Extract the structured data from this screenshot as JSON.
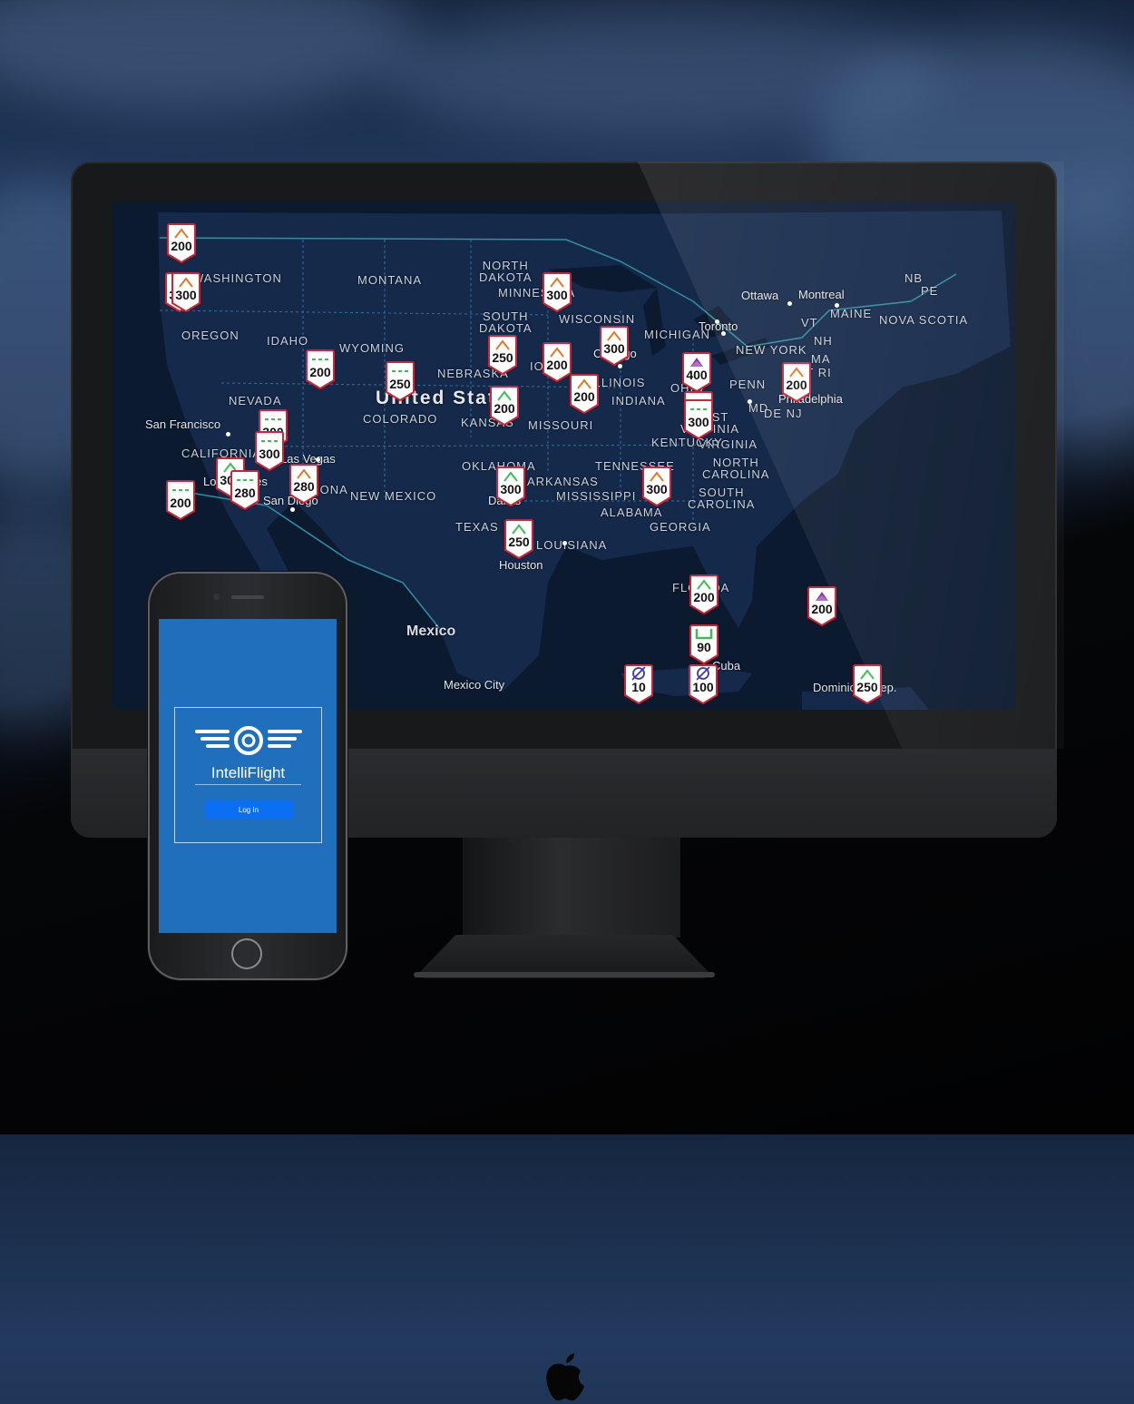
{
  "map": {
    "labels": [
      {
        "text": "NORTH\nDAKOTA",
        "type": "state"
      },
      {
        "text": "MONTANA",
        "type": "state"
      },
      {
        "text": "WASHINGTON",
        "type": "state"
      },
      {
        "text": "OREGON",
        "type": "state"
      },
      {
        "text": "IDAHO",
        "type": "state"
      },
      {
        "text": "WYOMING",
        "type": "state"
      },
      {
        "text": "SOUTH\nDAKOTA",
        "type": "state"
      },
      {
        "text": "NEBRASKA",
        "type": "state"
      },
      {
        "text": "NEVADA",
        "type": "state"
      },
      {
        "text": "COLORADO",
        "type": "state"
      },
      {
        "text": "KANSAS",
        "type": "state"
      },
      {
        "text": "MISSOURI",
        "type": "state"
      },
      {
        "text": "MINNESOTA",
        "type": "state"
      },
      {
        "text": "WISCONSIN",
        "type": "state"
      },
      {
        "text": "MICHIGAN",
        "type": "state"
      },
      {
        "text": "IOWA",
        "type": "state"
      },
      {
        "text": "ILLINOIS",
        "type": "state"
      },
      {
        "text": "INDIANA",
        "type": "state"
      },
      {
        "text": "OHIO",
        "type": "state"
      },
      {
        "text": "PENN",
        "type": "state"
      },
      {
        "text": "NEW YORK",
        "type": "state"
      },
      {
        "text": "VT",
        "type": "state"
      },
      {
        "text": "NH",
        "type": "state"
      },
      {
        "text": "MA",
        "type": "state"
      },
      {
        "text": "CT RI",
        "type": "state"
      },
      {
        "text": "MAINE",
        "type": "state"
      },
      {
        "text": "NB",
        "type": "state"
      },
      {
        "text": "PE",
        "type": "state"
      },
      {
        "text": "NOVA SCOTIA",
        "type": "state"
      },
      {
        "text": "MD",
        "type": "state"
      },
      {
        "text": "DE NJ",
        "type": "state"
      },
      {
        "text": "WEST\nVIRGINIA",
        "type": "state"
      },
      {
        "text": "VIRGINIA",
        "type": "state"
      },
      {
        "text": "KENTUCKY",
        "type": "state"
      },
      {
        "text": "TENNESSEE",
        "type": "state"
      },
      {
        "text": "NORTH\nCAROLINA",
        "type": "state"
      },
      {
        "text": "SOUTH\nCAROLINA",
        "type": "state"
      },
      {
        "text": "GEORGIA",
        "type": "state"
      },
      {
        "text": "ALABAMA",
        "type": "state"
      },
      {
        "text": "MISSISSIPPI",
        "type": "state"
      },
      {
        "text": "ARKANSAS",
        "type": "state"
      },
      {
        "text": "LOUISIANA",
        "type": "state"
      },
      {
        "text": "OKLAHOMA",
        "type": "state"
      },
      {
        "text": "TEXAS",
        "type": "state"
      },
      {
        "text": "NEW MEXICO",
        "type": "state"
      },
      {
        "text": "ARIZONA",
        "type": "state"
      },
      {
        "text": "CALIFORNIA",
        "type": "state"
      },
      {
        "text": "FLORIDA",
        "type": "state"
      },
      {
        "text": "Ottawa",
        "type": "city"
      },
      {
        "text": "Montreal",
        "type": "city"
      },
      {
        "text": "Toronto",
        "type": "city"
      },
      {
        "text": "Chicago",
        "type": "city"
      },
      {
        "text": "Philadelphia",
        "type": "city"
      },
      {
        "text": "San Francisco",
        "type": "city"
      },
      {
        "text": "Los Angeles",
        "type": "city"
      },
      {
        "text": "San Diego",
        "type": "city"
      },
      {
        "text": "Las Vegas",
        "type": "city"
      },
      {
        "text": "Dallas",
        "type": "city"
      },
      {
        "text": "Houston",
        "type": "city"
      },
      {
        "text": "Mexico City",
        "type": "city"
      },
      {
        "text": "Cuba",
        "type": "city"
      },
      {
        "text": "Dominican Rep.",
        "type": "city"
      },
      {
        "text": "United States",
        "type": "country"
      },
      {
        "text": "Mexico",
        "type": "country"
      }
    ],
    "markers": [
      {
        "value": "200",
        "symbol": "chevron",
        "color": "#e07a2a"
      },
      {
        "value": "300",
        "symbol": "chevron",
        "color": "#3bbf55"
      },
      {
        "value": "300",
        "symbol": "chevron",
        "color": "#e07a2a"
      },
      {
        "value": "300",
        "symbol": "chevron",
        "color": "#e07a2a"
      },
      {
        "value": "300",
        "symbol": "chevron",
        "color": "#e07a2a"
      },
      {
        "value": "200",
        "symbol": "chevron",
        "color": "#e07a2a"
      },
      {
        "value": "400",
        "symbol": "filled",
        "color": "#8e3aa8"
      },
      {
        "value": "200",
        "symbol": "dashed",
        "color": "#3bbf55"
      },
      {
        "value": "250",
        "symbol": "chevron",
        "color": "#e07a2a"
      },
      {
        "value": "250",
        "symbol": "dashed",
        "color": "#3bbf55"
      },
      {
        "value": "200",
        "symbol": "chevron",
        "color": "#3bbf55"
      },
      {
        "value": "200",
        "symbol": "chevron",
        "color": "#e07a2a"
      },
      {
        "value": "200",
        "symbol": "dashed",
        "color": "#3bbf55"
      },
      {
        "value": "200",
        "symbol": "chevron",
        "color": "#e07a2a"
      },
      {
        "value": "300",
        "symbol": "dashed",
        "color": "#3bbf55"
      },
      {
        "value": "300",
        "symbol": "dashed",
        "color": "#3bbf55"
      },
      {
        "value": "300",
        "symbol": "dashed",
        "color": "#3bbf55"
      },
      {
        "value": "200",
        "symbol": "dashed",
        "color": "#3bbf55"
      },
      {
        "value": "300",
        "symbol": "chevron",
        "color": "#3bbf55"
      },
      {
        "value": "280",
        "symbol": "chevron",
        "color": "#e07a2a"
      },
      {
        "value": "280",
        "symbol": "dashed",
        "color": "#3bbf55"
      },
      {
        "value": "300",
        "symbol": "chevron",
        "color": "#e07a2a"
      },
      {
        "value": "300",
        "symbol": "chevron",
        "color": "#3bbf55"
      },
      {
        "value": "250",
        "symbol": "chevron",
        "color": "#3bbf55"
      },
      {
        "value": "200",
        "symbol": "chevron",
        "color": "#3bbf55"
      },
      {
        "value": "200",
        "symbol": "filled",
        "color": "#8e3aa8"
      },
      {
        "value": "90",
        "symbol": "bracket",
        "color": "#3bbf55"
      },
      {
        "value": "10",
        "symbol": "nosign",
        "color": "#3a3aa8"
      },
      {
        "value": "100",
        "symbol": "nosign",
        "color": "#3a3aa8"
      },
      {
        "value": "250",
        "symbol": "chevron",
        "color": "#3bbf55"
      }
    ]
  },
  "phone": {
    "app_name": "IntelliFlight",
    "login_label": "Log In"
  },
  "colors": {
    "marker_border": "#cf2434",
    "screen_accent": "#1f6fbd",
    "map_water": "#0c1a30",
    "map_land": "#15294a"
  }
}
